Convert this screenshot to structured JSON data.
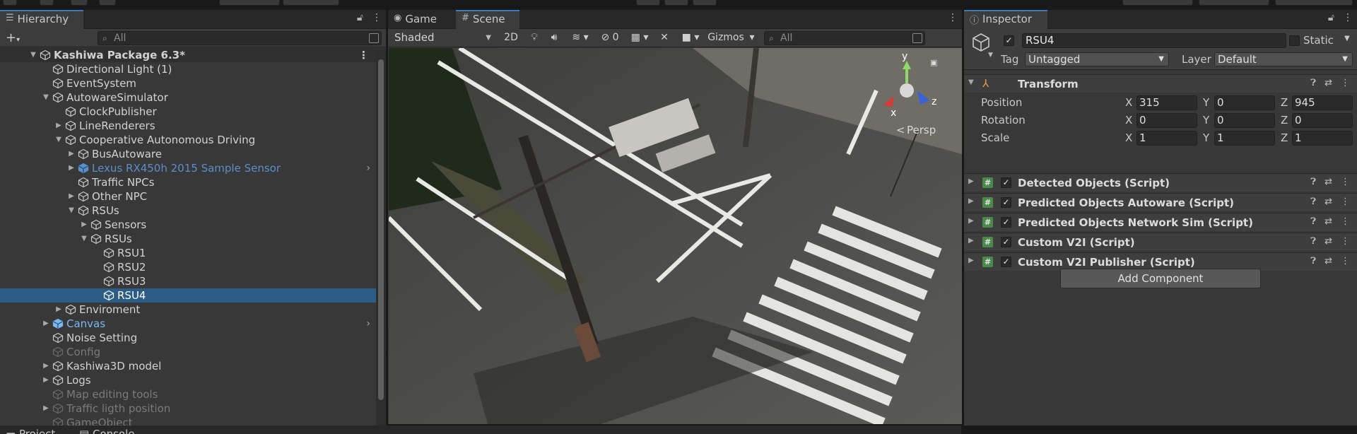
{
  "hierarchy": {
    "tab_label": "Hierarchy",
    "search_placeholder": "All",
    "items": [
      {
        "label": "Kashiwa Package 6.3*",
        "depth": 0,
        "arrow": "▼",
        "kind": "scene"
      },
      {
        "label": "Directional Light (1)",
        "depth": 1,
        "arrow": "",
        "kind": "go"
      },
      {
        "label": "EventSystem",
        "depth": 1,
        "arrow": "",
        "kind": "go"
      },
      {
        "label": "AutowareSimulator",
        "depth": 1,
        "arrow": "▼",
        "kind": "go"
      },
      {
        "label": "ClockPublisher",
        "depth": 2,
        "arrow": "",
        "kind": "go"
      },
      {
        "label": "LineRenderers",
        "depth": 2,
        "arrow": "▶",
        "kind": "go"
      },
      {
        "label": "Cooperative Autonomous Driving",
        "depth": 2,
        "arrow": "▼",
        "kind": "go"
      },
      {
        "label": "BusAutoware",
        "depth": 3,
        "arrow": "▶",
        "kind": "go"
      },
      {
        "label": "Lexus RX450h 2015 Sample Sensor",
        "depth": 3,
        "arrow": "▶",
        "kind": "prefab"
      },
      {
        "label": "Traffic NPCs",
        "depth": 3,
        "arrow": "",
        "kind": "go"
      },
      {
        "label": "Other NPC",
        "depth": 3,
        "arrow": "▶",
        "kind": "go"
      },
      {
        "label": "RSUs",
        "depth": 3,
        "arrow": "▼",
        "kind": "go"
      },
      {
        "label": "Sensors",
        "depth": 4,
        "arrow": "▶",
        "kind": "go"
      },
      {
        "label": "RSUs",
        "depth": 4,
        "arrow": "▼",
        "kind": "go"
      },
      {
        "label": "RSU1",
        "depth": 5,
        "arrow": "",
        "kind": "go"
      },
      {
        "label": "RSU2",
        "depth": 5,
        "arrow": "",
        "kind": "go"
      },
      {
        "label": "RSU3",
        "depth": 5,
        "arrow": "",
        "kind": "go"
      },
      {
        "label": "RSU4",
        "depth": 5,
        "arrow": "",
        "kind": "selected"
      },
      {
        "label": "Enviroment",
        "depth": 2,
        "arrow": "▶",
        "kind": "go"
      },
      {
        "label": "Canvas",
        "depth": 1,
        "arrow": "▶",
        "kind": "prefab-bright"
      },
      {
        "label": "Noise Setting",
        "depth": 1,
        "arrow": "",
        "kind": "go"
      },
      {
        "label": "Config",
        "depth": 1,
        "arrow": "",
        "kind": "dim"
      },
      {
        "label": "Kashiwa3D model",
        "depth": 1,
        "arrow": "▶",
        "kind": "go"
      },
      {
        "label": "Logs",
        "depth": 1,
        "arrow": "▶",
        "kind": "go"
      },
      {
        "label": "Map editing tools",
        "depth": 1,
        "arrow": "",
        "kind": "dim"
      },
      {
        "label": "Traffic ligth position",
        "depth": 1,
        "arrow": "▶",
        "kind": "dim"
      },
      {
        "label": "GameObject",
        "depth": 1,
        "arrow": "",
        "kind": "dim"
      }
    ]
  },
  "bottom_tabs": {
    "project": "Project",
    "console": "Console"
  },
  "scene": {
    "game_tab": "Game",
    "scene_tab": "Scene",
    "shading_mode": "Shaded",
    "mode_2d": "2D",
    "hidden_count": "0",
    "gizmos_label": "Gizmos",
    "search_placeholder": "All",
    "persp_label": "Persp",
    "axis_x": "x",
    "axis_y": "y",
    "axis_z": "z"
  },
  "inspector": {
    "tab_label": "Inspector",
    "object_name": "RSU4",
    "static_label": "Static",
    "tag_label": "Tag",
    "tag_value": "Untagged",
    "layer_label": "Layer",
    "layer_value": "Default",
    "transform": {
      "title": "Transform",
      "position_label": "Position",
      "rotation_label": "Rotation",
      "scale_label": "Scale",
      "x": "X",
      "y": "Y",
      "z": "Z",
      "position": [
        "315",
        "0",
        "945"
      ],
      "rotation": [
        "0",
        "0",
        "0"
      ],
      "scale": [
        "1",
        "1",
        "1"
      ]
    },
    "components": [
      "Detected Objects (Script)",
      "Predicted Objects Autoware (Script)",
      "Predicted Objects Network Sim (Script)",
      "Custom V2I (Script)",
      "Custom V2I Publisher (Script)"
    ],
    "add_component_label": "Add Component"
  },
  "colors": {
    "selection": "#2c5d87",
    "accent": "#3a79bb",
    "prefab_text": "#5a8fc8",
    "script_icon": "#4b8a4b"
  }
}
